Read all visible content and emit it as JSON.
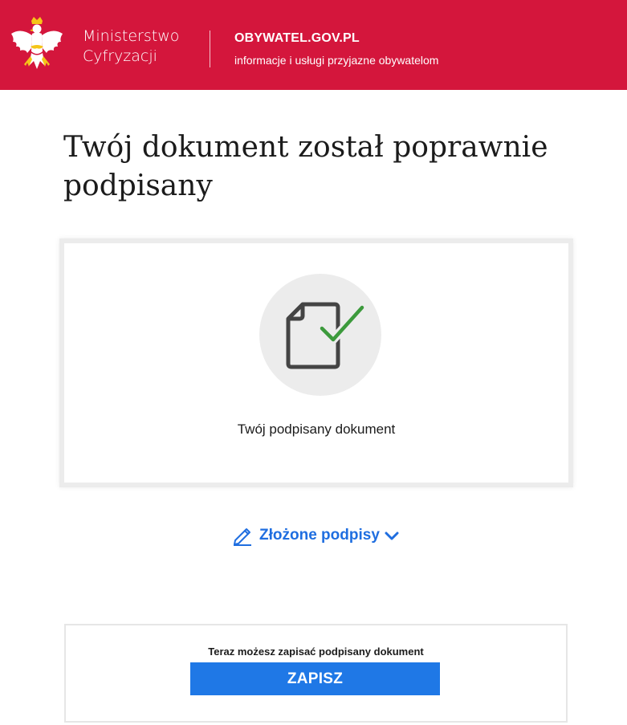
{
  "header": {
    "ministry_line1": "Ministerstwo",
    "ministry_line2": "Cyfryzacji",
    "portal_name": "OBYWATEL.GOV.PL",
    "portal_tagline": "informacje i usługi przyjazne obywatelom",
    "background_color": "#d4163c",
    "emblem_icon": "polish-eagle-emblem-icon"
  },
  "main": {
    "title": "Twój dokument został poprawnie podpisany",
    "document_card": {
      "icon": "signed-document-check-icon",
      "label": "Twój podpisany dokument",
      "check_color": "#3c9a3c"
    },
    "signatures_toggle": {
      "label": "Złożone podpisy",
      "leading_icon": "pencil-icon",
      "trailing_icon": "chevron-down-icon",
      "color": "#1f6ee0"
    },
    "save_section": {
      "prompt": "Teraz możesz zapisać podpisany dokument",
      "button_label": "ZAPISZ",
      "button_color": "#1f78e6"
    }
  }
}
